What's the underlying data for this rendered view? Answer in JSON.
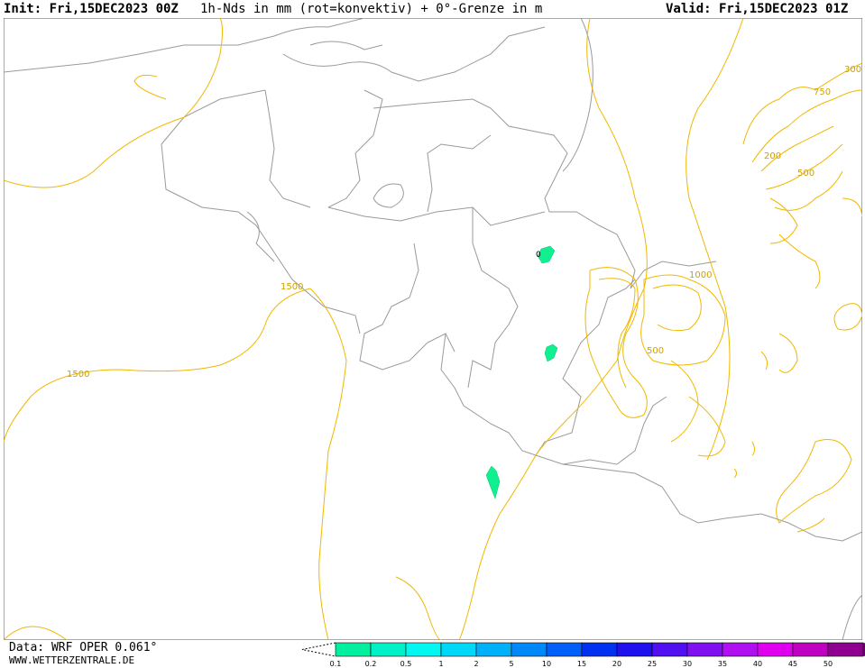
{
  "header": {
    "init": "Init: Fri,15DEC2023 00Z",
    "title": "1h-Nds in mm (rot=konvektiv) + 0°-Grenze in m",
    "valid": "Valid: Fri,15DEC2023 01Z"
  },
  "footer": {
    "data_source": "Data: WRF OPER 0.061°",
    "website": "WWW.WETTERZENTRALE.DE"
  },
  "contour_labels": [
    "1500",
    "1500",
    "1000",
    "500",
    "200",
    "500",
    "750",
    "300",
    "0"
  ],
  "colorbar": {
    "ticks": [
      "0.1",
      "0.2",
      "0.5",
      "1",
      "2",
      "5",
      "10",
      "15",
      "20",
      "25",
      "30",
      "35",
      "40",
      "45",
      "50"
    ],
    "colors": [
      "#00f0a0",
      "#00f0c8",
      "#00f8f0",
      "#00d8f8",
      "#00b0f8",
      "#0088f8",
      "#0060f8",
      "#0030f0",
      "#2010f0",
      "#5010f0",
      "#8010f0",
      "#b010f0",
      "#e000f0",
      "#c000c0",
      "#900090"
    ]
  },
  "colors": {
    "precip_light": "#10f090",
    "freezing_level": "#f0b800",
    "borders": "#999999"
  }
}
